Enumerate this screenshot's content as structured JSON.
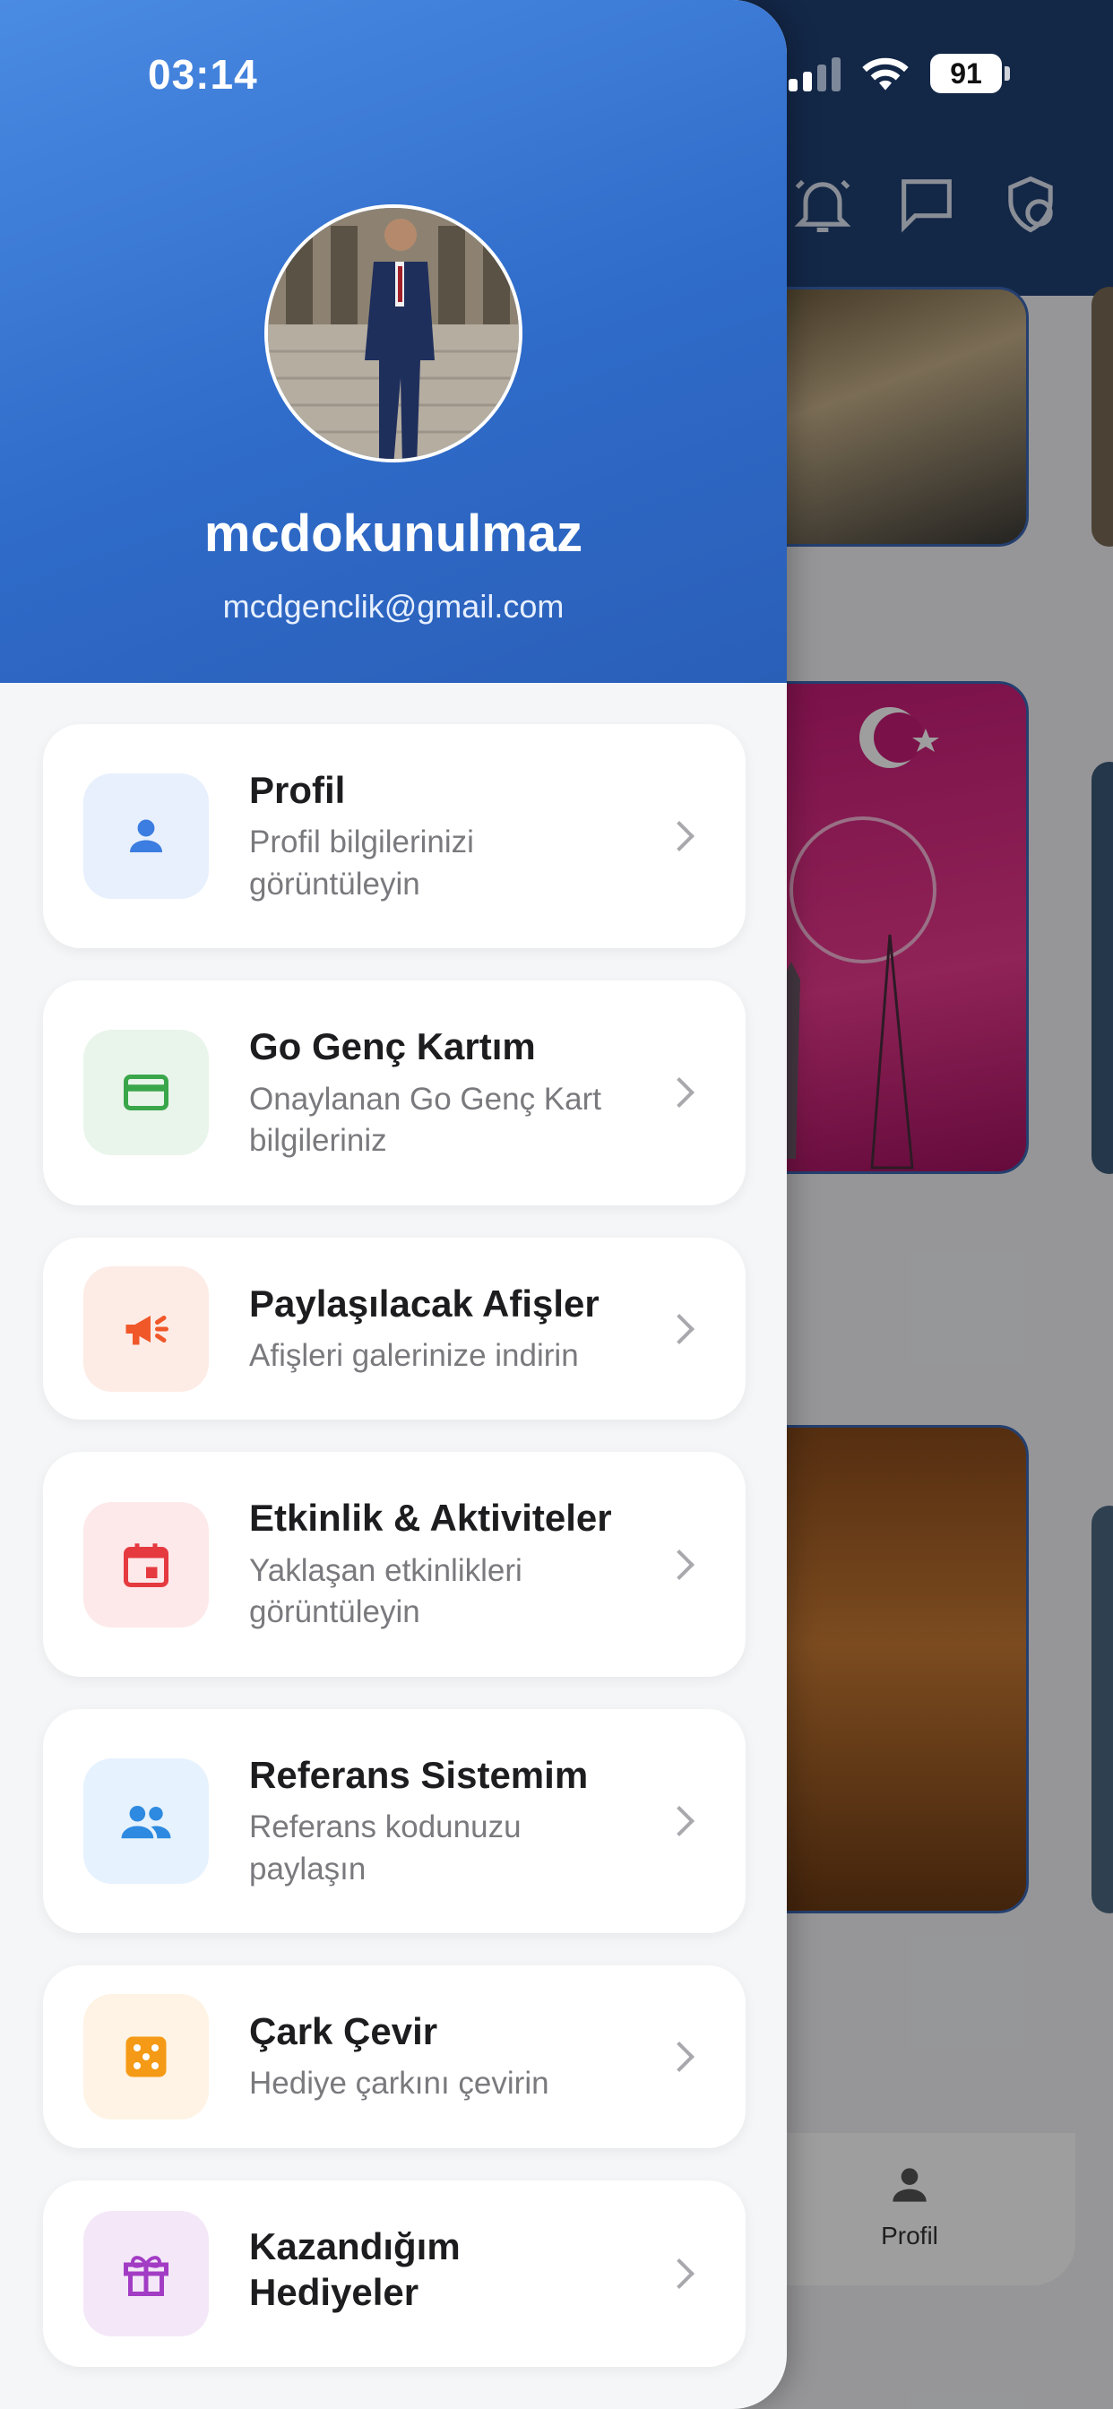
{
  "status_bar": {
    "time": "03:14",
    "battery": "91"
  },
  "user": {
    "name": "mcdokunulmaz",
    "email": "mcdgenclik@gmail.com"
  },
  "menu": [
    {
      "title": "Profil",
      "subtitle": "Profil bilgilerinizi görüntüleyin",
      "icon": "person-icon",
      "icon_bg": "#e8f0fd",
      "icon_color": "#3b7de0"
    },
    {
      "title": "Go Genç Kartım",
      "subtitle": "Onaylanan Go Genç Kart bilgileriniz",
      "icon": "credit-card-icon",
      "icon_bg": "#e9f5eb",
      "icon_color": "#3aa64a"
    },
    {
      "title": "Paylaşılacak Afişler",
      "subtitle": "Afişleri galerinize indirin",
      "icon": "megaphone-icon",
      "icon_bg": "#fdece6",
      "icon_color": "#f0582a"
    },
    {
      "title": "Etkinlik & Aktiviteler",
      "subtitle": "Yaklaşan etkinlikleri görüntüleyin",
      "icon": "calendar-icon",
      "icon_bg": "#fde9ea",
      "icon_color": "#e53a40"
    },
    {
      "title": "Referans Sistemim",
      "subtitle": "Referans kodunuzu paylaşın",
      "icon": "people-icon",
      "icon_bg": "#e6f2fd",
      "icon_color": "#2d8ae0"
    },
    {
      "title": "Çark Çevir",
      "subtitle": "Hediye çarkını çevirin",
      "icon": "dice-icon",
      "icon_bg": "#fef3e4",
      "icon_color": "#f59a16"
    },
    {
      "title": "Kazandığım Hediyeler",
      "subtitle": "",
      "icon": "gift-icon",
      "icon_bg": "#f4e8f8",
      "icon_color": "#a23cc4"
    }
  ],
  "background": {
    "tab_label": "Profil"
  }
}
